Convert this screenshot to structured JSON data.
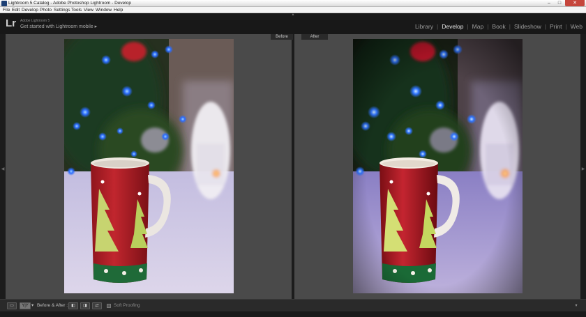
{
  "window": {
    "title": "Lightroom 5 Catalog - Adobe Photoshop Lightroom - Develop",
    "min_glyph": "–",
    "max_glyph": "□",
    "close_glyph": "✕"
  },
  "menu": {
    "items": [
      "File",
      "Edit",
      "Develop",
      "Photo",
      "Settings",
      "Tools",
      "View",
      "Window",
      "Help"
    ]
  },
  "identity": {
    "logo": "Lr",
    "product": "Adobe Lightroom 5",
    "mobile_prompt": "Get started with Lightroom mobile ▸"
  },
  "modules": {
    "items": [
      "Library",
      "Develop",
      "Map",
      "Book",
      "Slideshow",
      "Print",
      "Web"
    ],
    "active": "Develop"
  },
  "view": {
    "before_label": "Before",
    "after_label": "After"
  },
  "toolbar": {
    "loupe_glyph": "▭",
    "compare_glyph": "Y|Y",
    "compare_menu_glyph": "▾",
    "before_after_label": "Before & After :",
    "copy_before_to_after_glyph": "◧",
    "copy_after_to_before_glyph": "◨",
    "swap_glyph": "⇄",
    "soft_proofing_label": "Soft Proofing",
    "toolbar_menu_glyph": "▾"
  },
  "colors": {
    "accent": "#e6e6e6",
    "panel": "#4a4a4a",
    "mug_red": "#b21f27",
    "mug_green": "#1f6a38"
  }
}
